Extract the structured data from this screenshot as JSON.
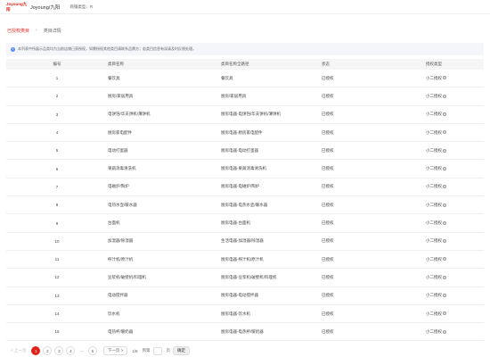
{
  "header": {
    "logo": "Joyoung九阳",
    "shop_name": "Joyoung/九阳",
    "store_type": "商铺类型：R"
  },
  "breadcrumb": {
    "parent": "已授权类目",
    "current": "类目详情"
  },
  "notice": "本列表中所展示品类均为当前店铺已获授权，如需授权其他类目请联系品牌方；若类目信息有误请及时反馈处理。",
  "table": {
    "headers": {
      "idx": "编号",
      "name": "类目名称",
      "path": "类目名称全路径",
      "status": "状态",
      "auth": "授权类型"
    },
    "rows": [
      {
        "idx": "1",
        "name": "餐饮具",
        "path": "餐饮具",
        "status": "已授权",
        "auth": "小二授权"
      },
      {
        "idx": "2",
        "name": "厨房/家居用具",
        "path": "厨房/家居用具",
        "status": "已授权",
        "auth": "小二授权"
      },
      {
        "idx": "3",
        "name": "电饼铛/华夫饼机/薄饼机",
        "path": "厨房电器-电饼铛/华夫饼机/薄饼机",
        "status": "已授权",
        "auth": "小二授权"
      },
      {
        "idx": "4",
        "name": "厨房家电配件",
        "path": "厨房电器-厨房家电配件",
        "status": "已授权",
        "auth": "小二授权"
      },
      {
        "idx": "5",
        "name": "电动打蛋器",
        "path": "厨房电器-电动打蛋器",
        "status": "已授权",
        "auth": "小二授权"
      },
      {
        "idx": "6",
        "name": "果蔬消毒清洗机",
        "path": "厨房电器-果蔬消毒清洗机",
        "status": "已授权",
        "auth": "小二授权"
      },
      {
        "idx": "7",
        "name": "电磁炉/陶炉",
        "path": "厨房电器-电磁炉/陶炉",
        "status": "已授权",
        "auth": "小二授权"
      },
      {
        "idx": "8",
        "name": "电热水壶/暖水器",
        "path": "厨房电器-电热水壶/暖水器",
        "status": "已授权",
        "auth": "小二授权"
      },
      {
        "idx": "9",
        "name": "台面机",
        "path": "厨房电器-台面机",
        "status": "已授权",
        "auth": "小二授权"
      },
      {
        "idx": "10",
        "name": "加湿器/除湿器",
        "path": "生活电器-加湿器/除湿器",
        "status": "已授权",
        "auth": "小二授权"
      },
      {
        "idx": "11",
        "name": "榨汁机/原汁机",
        "path": "厨房电器-榨汁机/原汁机",
        "status": "已授权",
        "auth": "小二授权"
      },
      {
        "idx": "12",
        "name": "豆浆机/破壁机/料理机",
        "path": "厨房电器-豆浆机/破壁机/料理机",
        "status": "已授权",
        "auth": "小二授权"
      },
      {
        "idx": "13",
        "name": "电动搅拌器",
        "path": "厨房电器-电动搅拌器",
        "status": "已授权",
        "auth": "小二授权"
      },
      {
        "idx": "14",
        "name": "饮水机",
        "path": "厨房电器-饮水机",
        "status": "已授权",
        "auth": "小二授权"
      },
      {
        "idx": "15",
        "name": "电热杯/暖奶器",
        "path": "厨房电器-电热杯/暖奶器",
        "status": "已授权",
        "auth": "小二授权"
      }
    ]
  },
  "pager": {
    "prev": "< 上一页",
    "pages": [
      "1",
      "2",
      "3",
      "4"
    ],
    "dots": "···",
    "last": "6",
    "next": "下一页 >",
    "info": "1/6",
    "jump_label": "到第",
    "page_unit": "页",
    "go": "确定"
  },
  "colors": {
    "brand": "#e2231a",
    "header_bg": "#f5f5f5",
    "notice_bg": "#f4f6fa"
  }
}
